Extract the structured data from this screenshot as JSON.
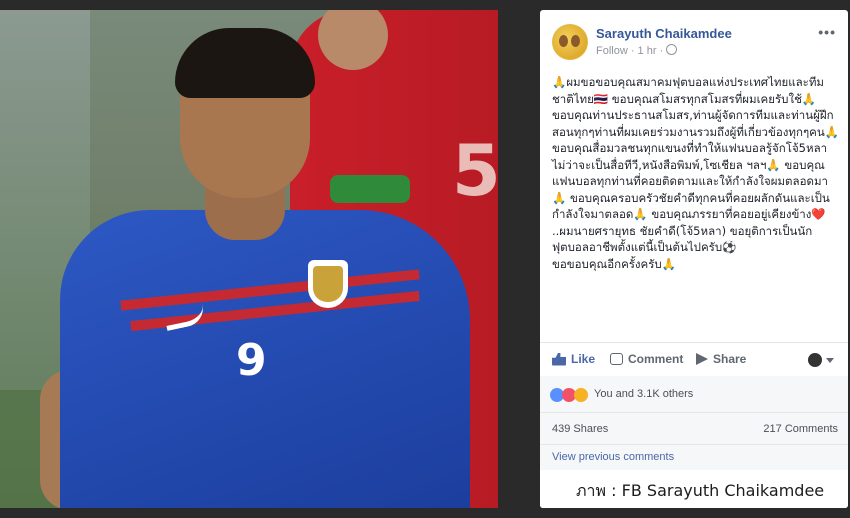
{
  "post": {
    "author": "Sarayuth Chaikamdee",
    "meta": "Follow · 1 hr ·",
    "more": "•••",
    "body": [
      "🙏ผมขอขอบคุณสมาคมฟุตบอลแห่งประเทศไทยและทีมชาติไทย🇹🇭 ขอบคุณสโมสรทุกสโมสรที่ผมเคยรับใช้🙏 ขอบคุณท่านประธานสโมสร,ท่านผู้จัดการทีมและท่านผู้ฝึกสอนทุกๆท่านที่ผมเคยร่วมงานรวมถึงผู้ที่เกี่ยวข้องทุกๆคน🙏 ขอบคุณสื่อมวลชนทุกแขนงที่ทำให้แฟนบอลรู้จักโจ้5หลาไม่ว่าจะเป็นสื่อทีวี,หนังสือพิมพ์,โซเชียล ฯลฯ🙏 ขอบคุณแฟนบอลทุกท่านที่คอยติดตามและให้กำลังใจผมตลอดมา🙏 ขอบคุณครอบครัวชัยคำดีทุกคนที่คอยผลักดันและเป็นกำลังใจมาตลอด🙏 ขอบคุณภรรยาที่คอยอยู่เคียงข้าง❤️",
      "..ผมนายศรายุทธ ชัยคำดี(โจ้5หลา) ขอยุติการเป็นนักฟุตบอลอาชีพตั้งแต่นี้เป็นต้นไปครับ⚽️",
      "ขอขอบคุณอีกครั้งครับ🙏"
    ]
  },
  "actions": {
    "like": "Like",
    "comment": "Comment",
    "share": "Share"
  },
  "reactions_text": "You and 3.1K others",
  "counts": {
    "shares": "439 Shares",
    "comments": "217 Comments"
  },
  "view_previous": "View previous comments",
  "credit": "ภาพ : FB Sarayuth Chaikamdee",
  "colors": {
    "link_blue": "#365899",
    "like_blue": "#4b67a8",
    "jersey_blue": "#2d58c4",
    "opponent_red": "#c91f2a"
  }
}
